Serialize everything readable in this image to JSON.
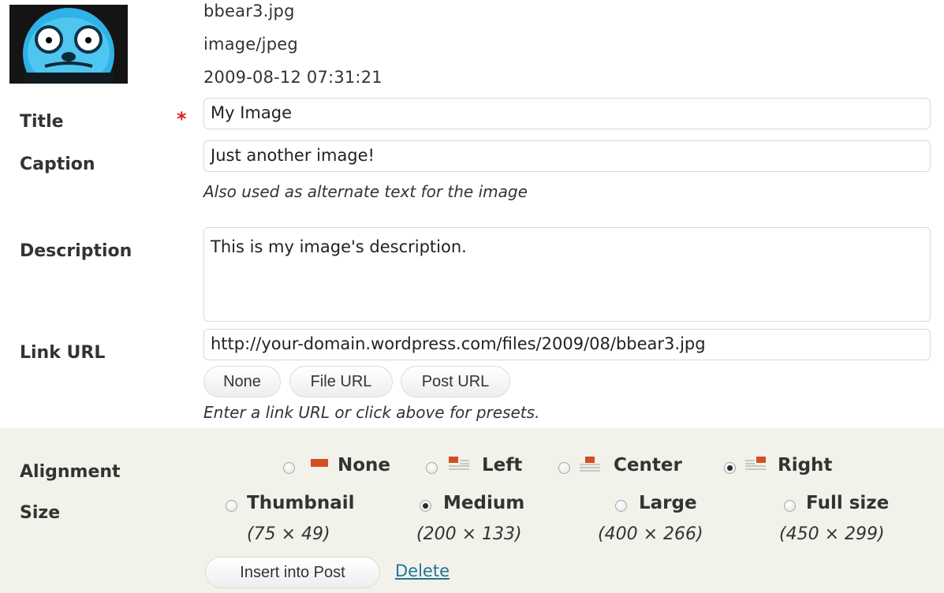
{
  "file": {
    "name": "bbear3.jpg",
    "mime": "image/jpeg",
    "date": "2009-08-12 07:31:21"
  },
  "fields": {
    "title_label": "Title",
    "title_value": "My Image",
    "caption_label": "Caption",
    "caption_value": "Just another image!",
    "caption_help": "Also used as alternate text for the image",
    "description_label": "Description",
    "description_value": "This is my image's description.",
    "link_label": "Link URL",
    "link_value": "http://your-domain.wordpress.com/files/2009/08/bbear3.jpg",
    "link_help": "Enter a link URL or click above for presets."
  },
  "link_buttons": [
    "None",
    "File URL",
    "Post URL"
  ],
  "alignment": {
    "label": "Alignment",
    "selected": "Right",
    "options": [
      "None",
      "Left",
      "Center",
      "Right"
    ]
  },
  "size": {
    "label": "Size",
    "selected": "Medium",
    "options": [
      {
        "name": "Thumbnail",
        "dims": "(75 × 49)"
      },
      {
        "name": "Medium",
        "dims": "(200 × 133)"
      },
      {
        "name": "Large",
        "dims": "(400 × 266)"
      },
      {
        "name": "Full size",
        "dims": "(450 × 299)"
      }
    ]
  },
  "actions": {
    "insert": "Insert into Post",
    "delete": "Delete"
  },
  "colors": {
    "required": "#e0201f",
    "link": "#21759b",
    "panel": "#f2f1ea",
    "align_icon_accent": "#d54e21"
  }
}
